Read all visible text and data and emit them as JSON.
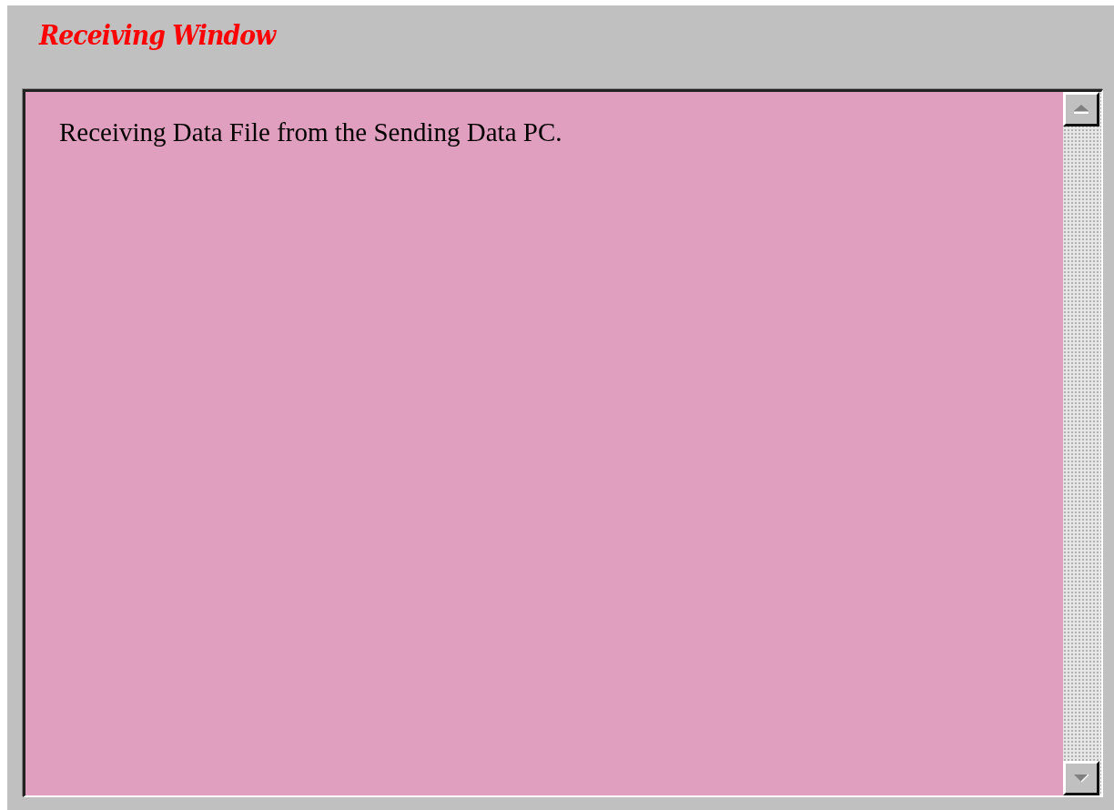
{
  "window": {
    "title": "Receiving Window"
  },
  "text_area": {
    "value": "Receiving Data File from the Sending Data PC."
  }
}
